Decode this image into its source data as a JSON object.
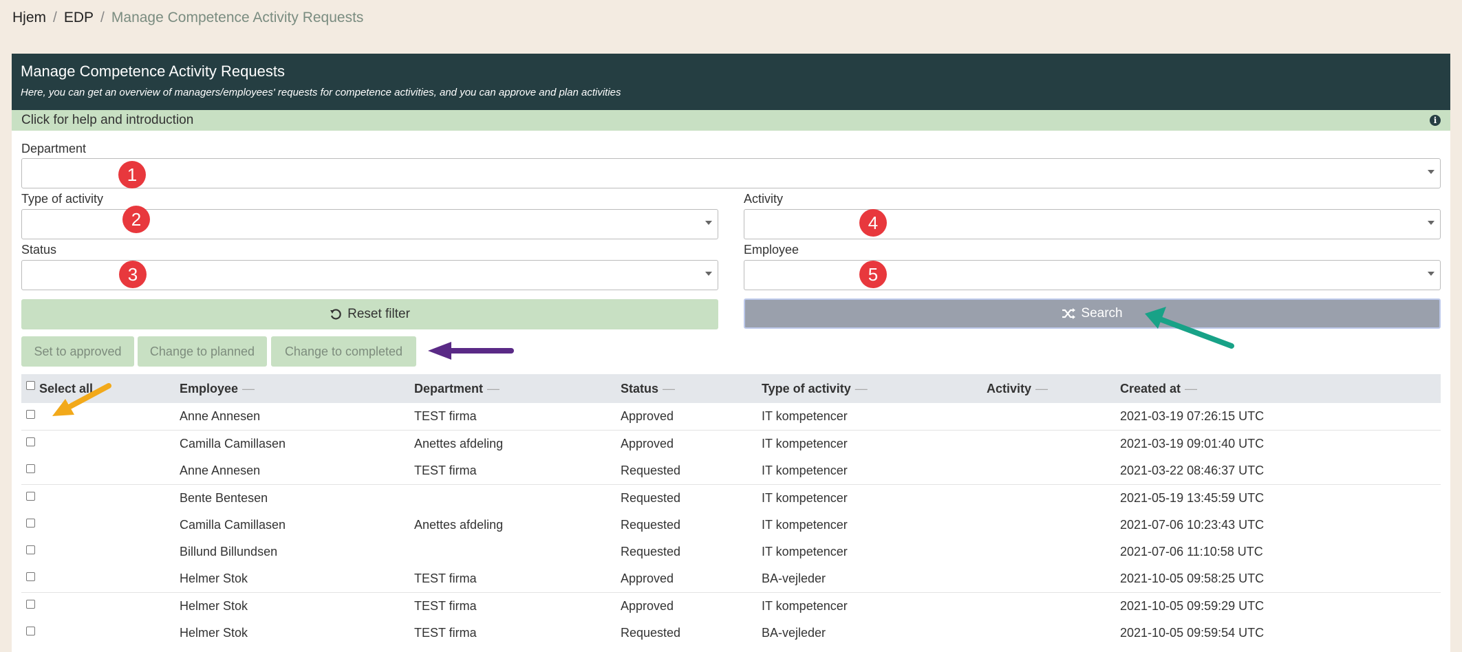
{
  "breadcrumb": {
    "home": "Hjem",
    "section": "EDP",
    "current": "Manage Competence Activity Requests",
    "separator": "/"
  },
  "header": {
    "title": "Manage Competence Activity Requests",
    "subtitle": "Here, you can get an overview of managers/employees' requests for competence activities, and you can approve and plan activities"
  },
  "help": {
    "label": "Click for help and introduction",
    "icon": "info-icon"
  },
  "filters": {
    "department": {
      "label": "Department",
      "value": ""
    },
    "type_of_activity": {
      "label": "Type of activity",
      "value": ""
    },
    "activity": {
      "label": "Activity",
      "value": ""
    },
    "status": {
      "label": "Status",
      "value": ""
    },
    "employee": {
      "label": "Employee",
      "value": ""
    }
  },
  "markers": [
    "1",
    "2",
    "3",
    "4",
    "5"
  ],
  "buttons": {
    "reset": "Reset filter",
    "search": "Search",
    "set_approved": "Set to approved",
    "change_planned": "Change to planned",
    "change_completed": "Change to completed"
  },
  "table": {
    "select_all": "Select all",
    "sort_glyph": "—",
    "columns": [
      "Employee",
      "Department",
      "Status",
      "Type of activity",
      "Activity",
      "Created at"
    ],
    "rows": [
      {
        "employee": "Anne Annesen",
        "department": "TEST firma",
        "status": "Approved",
        "type": "IT kompetencer",
        "activity": "",
        "created": "2021-03-19 07:26:15 UTC"
      },
      {
        "employee": "Camilla Camillasen",
        "department": "Anettes afdeling",
        "status": "Approved",
        "type": "IT kompetencer",
        "activity": "",
        "created": "2021-03-19 09:01:40 UTC"
      },
      {
        "employee": "Anne Annesen",
        "department": "TEST firma",
        "status": "Requested",
        "type": "IT kompetencer",
        "activity": "",
        "created": "2021-03-22 08:46:37 UTC"
      },
      {
        "employee": "Bente Bentesen",
        "department": "",
        "status": "Requested",
        "type": "IT kompetencer",
        "activity": "",
        "created": "2021-05-19 13:45:59 UTC"
      },
      {
        "employee": "Camilla Camillasen",
        "department": "Anettes afdeling",
        "status": "Requested",
        "type": "IT kompetencer",
        "activity": "",
        "created": "2021-07-06 10:23:43 UTC"
      },
      {
        "employee": "Billund Billundsen",
        "department": "",
        "status": "Requested",
        "type": "IT kompetencer",
        "activity": "",
        "created": "2021-07-06 11:10:58 UTC"
      },
      {
        "employee": "Helmer Stok",
        "department": "TEST firma",
        "status": "Approved",
        "type": "BA-vejleder",
        "activity": "",
        "created": "2021-10-05 09:58:25 UTC"
      },
      {
        "employee": "Helmer Stok",
        "department": "TEST firma",
        "status": "Approved",
        "type": "IT kompetencer",
        "activity": "",
        "created": "2021-10-05 09:59:29 UTC"
      },
      {
        "employee": "Helmer Stok",
        "department": "TEST firma",
        "status": "Requested",
        "type": "BA-vejleder",
        "activity": "",
        "created": "2021-10-05 09:59:54 UTC"
      }
    ]
  },
  "colors": {
    "header_bg": "#253e42",
    "help_bg": "#c8e0c3",
    "marker": "#e8383d",
    "arrow_green": "#18a287",
    "arrow_purple": "#5a2a86",
    "arrow_orange": "#f2a91a"
  }
}
